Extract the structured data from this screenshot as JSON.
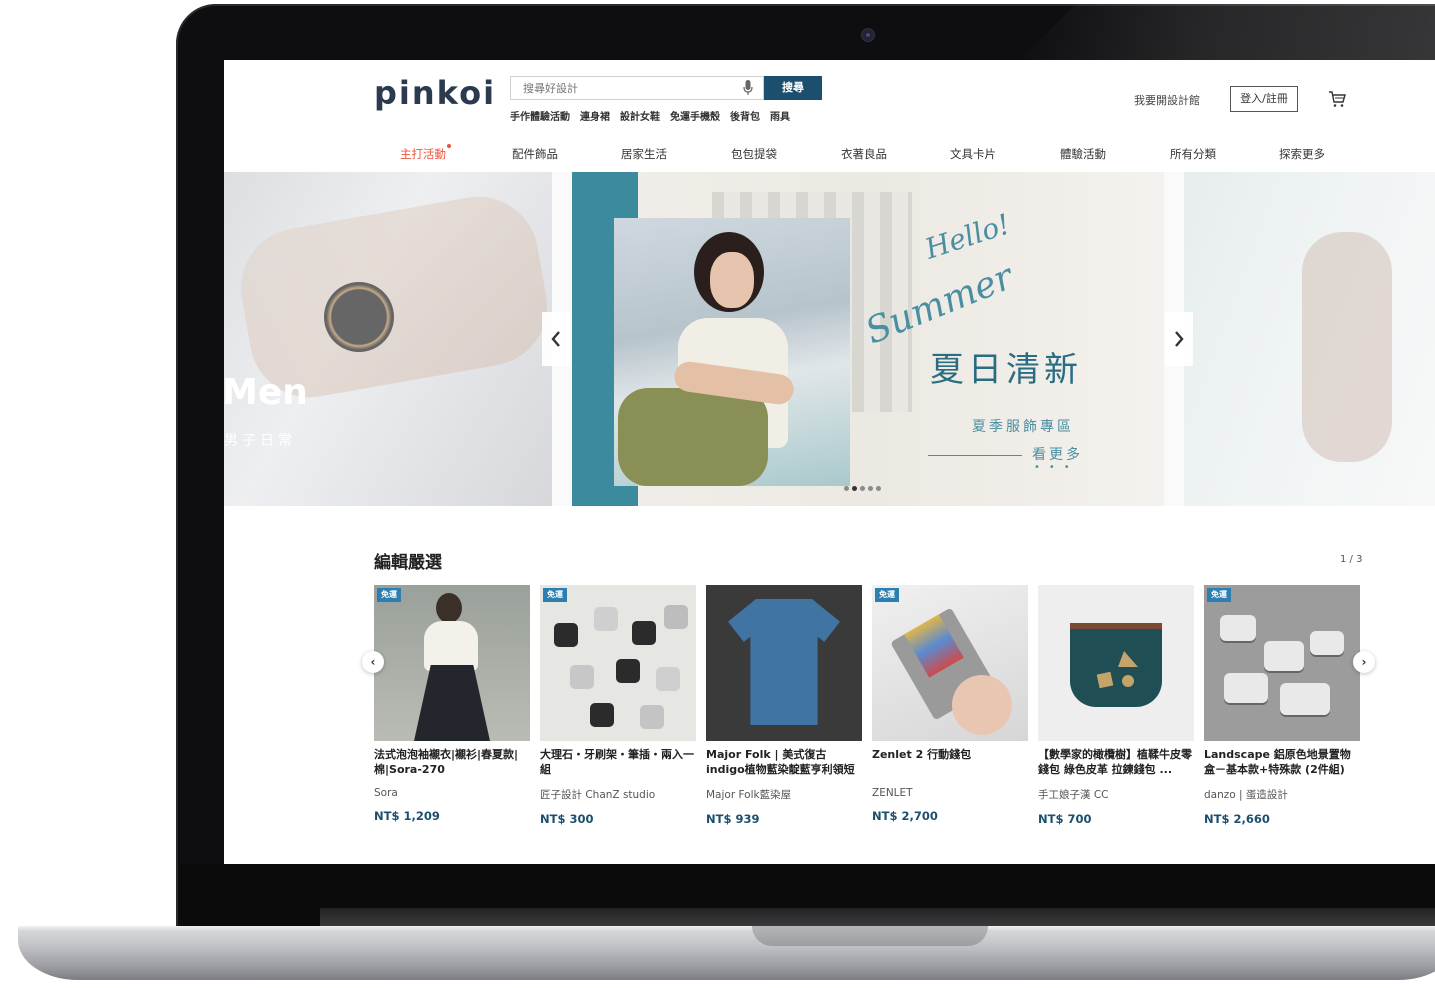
{
  "header": {
    "logo": "pinkoi",
    "search_placeholder": "搜尋好設計",
    "search_button": "搜尋",
    "hot_tags": [
      "手作體驗活動",
      "連身裙",
      "設計女鞋",
      "免運手機殼",
      "後背包",
      "雨具"
    ],
    "open_shop": "我要開設計館",
    "login": "登入/註冊"
  },
  "nav": {
    "items": [
      "主打活動",
      "配件飾品",
      "居家生活",
      "包包提袋",
      "衣著良品",
      "文具卡片",
      "體驗活動",
      "所有分類",
      "探索更多"
    ],
    "active_index": 0
  },
  "carousel": {
    "left_slide": {
      "title": "Men",
      "subtitle": "男子日常"
    },
    "center_slide": {
      "script_line1": "Hello!",
      "script_line2": "Summer",
      "title": "夏日清新",
      "subtitle": "夏季服飾專區",
      "more": "看更多"
    },
    "dot_count": 5,
    "active_dot": 1
  },
  "editor_picks": {
    "title": "編輯嚴選",
    "pager": "1 / 3",
    "products": [
      {
        "badge": "免運",
        "title": "法式泡泡袖襯衣|襯衫|春夏款|棉|Sora-270",
        "shop": "Sora",
        "price": "NT$ 1,209"
      },
      {
        "badge": "免運",
        "title": "大理石・牙刷架・筆插・兩入一組",
        "shop": "匠子設計 ChanZ studio",
        "price": "NT$ 300"
      },
      {
        "badge": "",
        "title": "Major Folk | 美式復古indigo植物藍染靛藍亨利領短袖TE...",
        "shop": "Major Folk藍染屋",
        "price": "NT$ 939"
      },
      {
        "badge": "免運",
        "title": "Zenlet 2 行動錢包",
        "shop": "ZENLET",
        "price": "NT$ 2,700"
      },
      {
        "badge": "",
        "title": "【數學家的橄欖樹】植鞣牛皮零錢包 綠色皮革 拉鍊錢包 ...",
        "shop": "手工娘子漢 CC",
        "price": "NT$ 700"
      },
      {
        "badge": "免運",
        "title": "Landscape 鋁原色地景置物盒－基本款+特殊款 (2件組)",
        "shop": "danzo | 蛋造設計",
        "price": "NT$ 2,660"
      }
    ]
  },
  "colors": {
    "brand_dark": "#1c4f6e",
    "accent": "#e8553e",
    "badge": "#2c7fb0",
    "teal": "#3c8a9e"
  }
}
